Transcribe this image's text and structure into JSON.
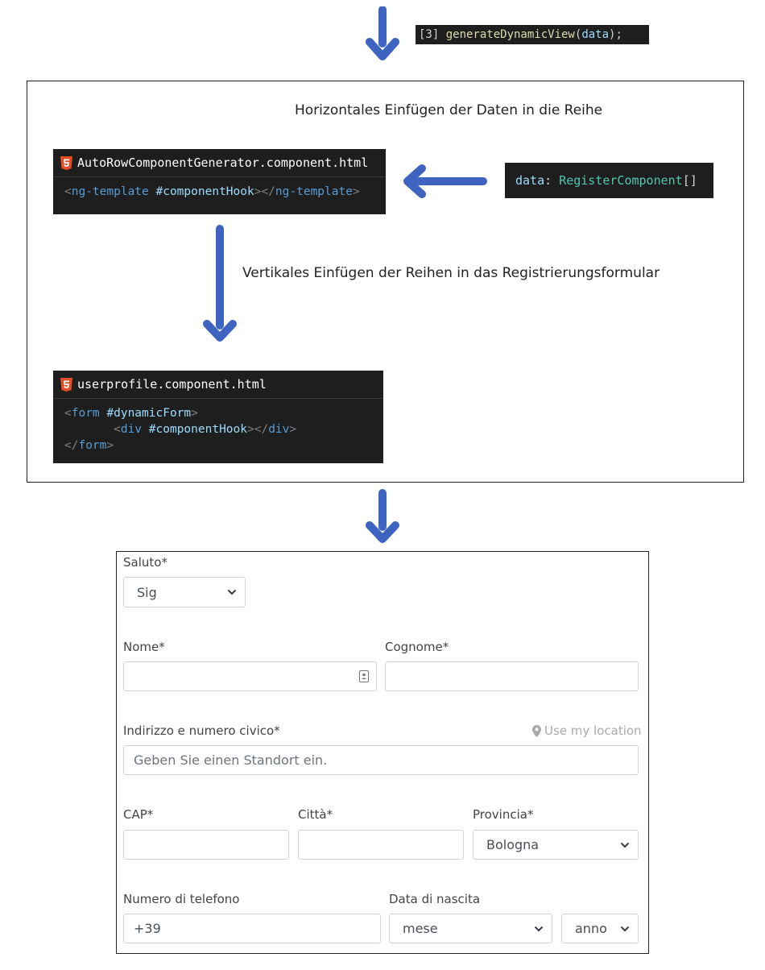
{
  "call_snippet": {
    "prefix": "[3] ",
    "fn": "generateDynamicView",
    "open": "(",
    "arg": "data",
    "close": ");"
  },
  "captions": {
    "horizontal": "Horizontales Einfügen der Daten in die Reihe",
    "vertical": "Vertikales Einfügen der Reihen in das Registrierungsformular"
  },
  "row_template_card": {
    "file": "AutoRowComponentGenerator.component.html",
    "open_lt": "<",
    "open_tag": "ng-template",
    "ref": " #componentHook",
    "mid": "></",
    "close_tag": "ng-template",
    "end": ">"
  },
  "data_snippet": {
    "name": "data",
    "colon": ": ",
    "type": "RegisterComponent",
    "brackets": "[]"
  },
  "userprofile_card": {
    "file": "userprofile.component.html",
    "line1_lt": "<",
    "line1_tag": "form",
    "line1_ref": " #dynamicForm",
    "line1_gt": ">",
    "line2_indent": "       ",
    "line2_lt": "<",
    "line2_tag": "div",
    "line2_ref": " #componentHook",
    "line2_mid": "></",
    "line2_close": "div",
    "line2_gt": ">",
    "line3_lt": "</",
    "line3_tag": "form",
    "line3_gt": ">"
  },
  "form": {
    "saluto_label": "Saluto*",
    "saluto_value": "Sig",
    "nome_label": "Nome*",
    "cognome_label": "Cognome*",
    "indirizzo_label": "Indirizzo e numero civico*",
    "use_location": "Use my location",
    "indirizzo_placeholder": "Geben Sie einen Standort ein.",
    "cap_label": "CAP*",
    "citta_label": "Città*",
    "provincia_label": "Provincia*",
    "provincia_value": "Bologna",
    "telefono_label": "Numero di telefono",
    "telefono_value": "+39",
    "nascita_label": "Data di nascita",
    "mese_value": "mese",
    "anno_value": "anno"
  },
  "colors": {
    "arrow": "#3f63c0",
    "code_bg": "#1e1e1e",
    "html5": "#e44d26"
  },
  "icons": [
    "arrow-down-icon",
    "arrow-left-icon",
    "html5-icon",
    "chevron-down-icon",
    "map-pin-icon",
    "contact-card-icon"
  ]
}
